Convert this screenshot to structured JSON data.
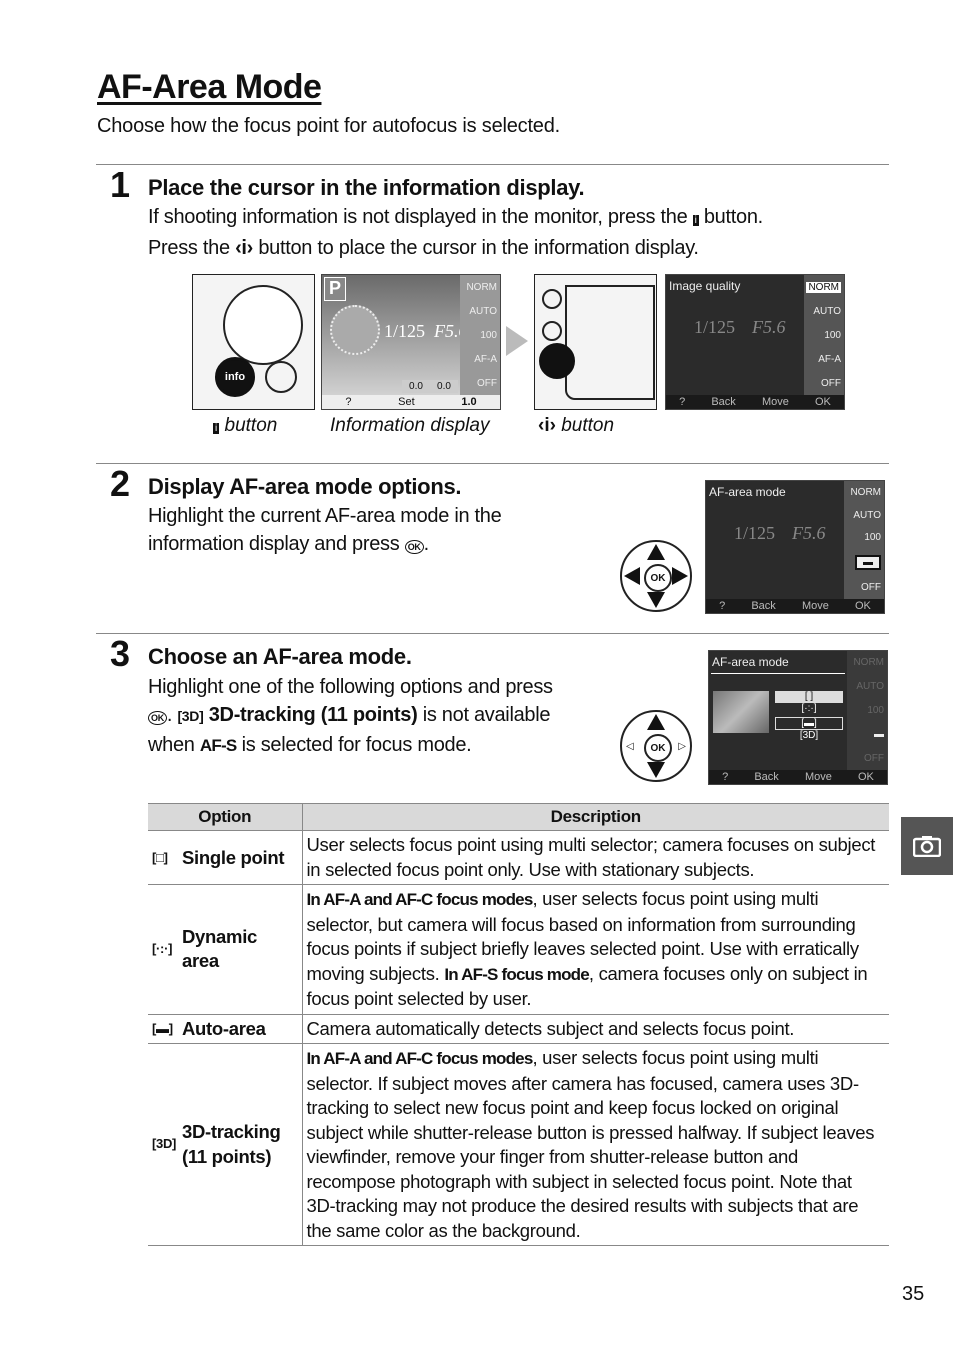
{
  "title": "AF-Area Mode",
  "subtitle": "Choose how the focus point for autofocus is selected.",
  "steps": [
    {
      "number": "1",
      "heading": "Place the cursor in the information display.",
      "lines": [
        "If shooting information is not displayed in the monitor, press the",
        "button.",
        "Press the",
        "button to place the cursor in the information display."
      ]
    },
    {
      "number": "2",
      "heading": "Display AF-area mode options.",
      "lines": [
        "Highlight the current AF-area mode in the",
        "information display and press",
        "."
      ]
    },
    {
      "number": "3",
      "heading": "Choose an AF-area mode.",
      "lines": [
        "Highlight one of the following options and press",
        ".",
        "3D-tracking (11 points)",
        "is not available",
        "when",
        "AF-S",
        "is selected for focus mode."
      ]
    }
  ],
  "captions": {
    "info_button": "button",
    "info_display": "Information display",
    "i_button": "button"
  },
  "screens": {
    "info": {
      "mode": "P",
      "shutter": "1/125",
      "aperture": "F5.6",
      "side": [
        "NORM",
        "AUTO",
        "100",
        "AF-A",
        "OFF"
      ],
      "bottom": [
        "?",
        "Set",
        "1.0"
      ],
      "exposure": [
        "0.0",
        "0.0"
      ]
    },
    "image_quality": {
      "title": "Image quality",
      "bottom": [
        "?",
        "Back",
        "Move",
        "OK"
      ]
    },
    "af_area": {
      "title": "AF-area mode",
      "bottom": [
        "?",
        "Back",
        "Move",
        "OK"
      ],
      "options": [
        "[ ]",
        "[·:·]",
        "[▬]",
        "[3D]"
      ]
    }
  },
  "table": {
    "headers": [
      "Option",
      "Description"
    ],
    "rows": [
      {
        "icon": "[□]",
        "option": "Single point",
        "desc": "User selects focus point using multi selector; camera focuses on subject in selected focus point only.  Use with stationary subjects."
      },
      {
        "icon": "[·:·]",
        "option": "Dynamic area",
        "cond1": "In AF-A and AF-C focus modes",
        "desc1": ", user selects focus point using multi selector, but camera will focus based on information from surrounding focus points if subject briefly leaves selected point.  Use with erratically moving subjects.  ",
        "cond2": "In AF-S focus mode",
        "desc2": ", camera focuses only on subject in focus point selected by user."
      },
      {
        "icon": "[▬]",
        "option": "Auto-area",
        "desc": "Camera automatically detects subject and selects focus point."
      },
      {
        "icon": "[3D]",
        "option": "3D-tracking (11 points)",
        "cond1": "In AF-A and AF-C focus modes",
        "desc1": ", user selects focus point using multi selector.  If subject moves after camera has focused, camera uses 3D-tracking to select new focus point and keep focus locked on original subject while shutter-release button is pressed halfway.  If subject leaves viewfinder, remove your finger from shutter-release button and recompose photograph with subject in selected focus point.  Note that 3D-tracking may not produce the desired results with subjects that are the same color as the background."
      }
    ]
  },
  "side_tab_icon": "camera-icon",
  "page_number": "35"
}
